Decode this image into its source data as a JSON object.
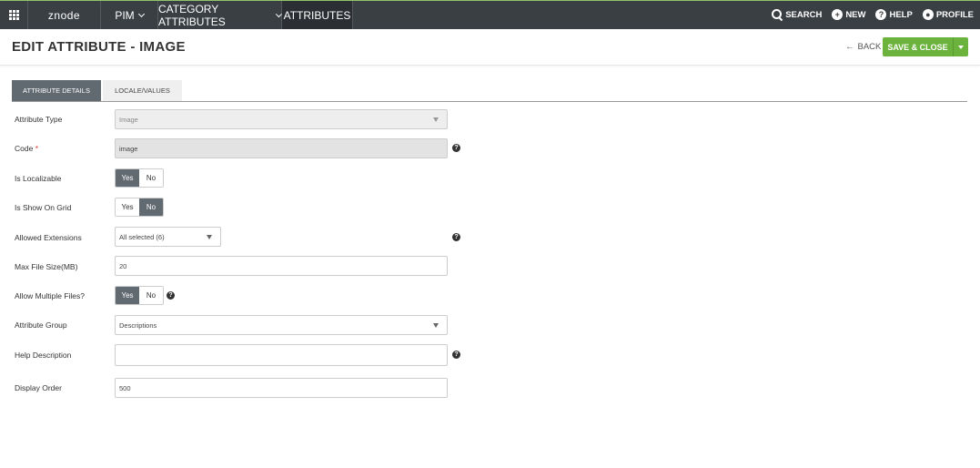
{
  "nav": {
    "logo": "znode",
    "pim": "PIM",
    "category_attributes": "CATEGORY ATTRIBUTES",
    "attributes": "ATTRIBUTES",
    "search": "SEARCH",
    "new": "NEW",
    "help": "HELP",
    "profile": "PROFILE"
  },
  "header": {
    "title": "EDIT ATTRIBUTE - IMAGE",
    "back": "BACK",
    "save_close": "SAVE & CLOSE"
  },
  "tabs": {
    "details": "ATTRIBUTE DETAILS",
    "locale": "LOCALE/VALUES"
  },
  "form": {
    "attribute_type": {
      "label": "Attribute Type",
      "value": "Image"
    },
    "code": {
      "label": "Code",
      "required_mark": "*",
      "value": "image"
    },
    "is_localizable": {
      "label": "Is Localizable",
      "yes": "Yes",
      "no": "No",
      "selected": "Yes"
    },
    "is_show_on_grid": {
      "label": "Is Show On Grid",
      "yes": "Yes",
      "no": "No",
      "selected": "No"
    },
    "allowed_extensions": {
      "label": "Allowed Extensions",
      "value": "All selected (6)"
    },
    "max_file_size": {
      "label": "Max File Size(MB)",
      "value": "20"
    },
    "allow_multiple": {
      "label": "Allow Multiple Files?",
      "yes": "Yes",
      "no": "No",
      "selected": "Yes"
    },
    "attribute_group": {
      "label": "Attribute Group",
      "value": "Descriptions"
    },
    "help_description": {
      "label": "Help Description",
      "value": ""
    },
    "display_order": {
      "label": "Display Order",
      "value": "500"
    }
  },
  "colors": {
    "topbar": "#3a3f44",
    "accent_green": "#6cb33e",
    "toggle_active": "#616971"
  },
  "icons": {
    "apps": "grid-icon",
    "search": "search-icon",
    "new": "plus-circle-icon",
    "help": "question-circle-icon",
    "profile": "user-circle-icon"
  }
}
